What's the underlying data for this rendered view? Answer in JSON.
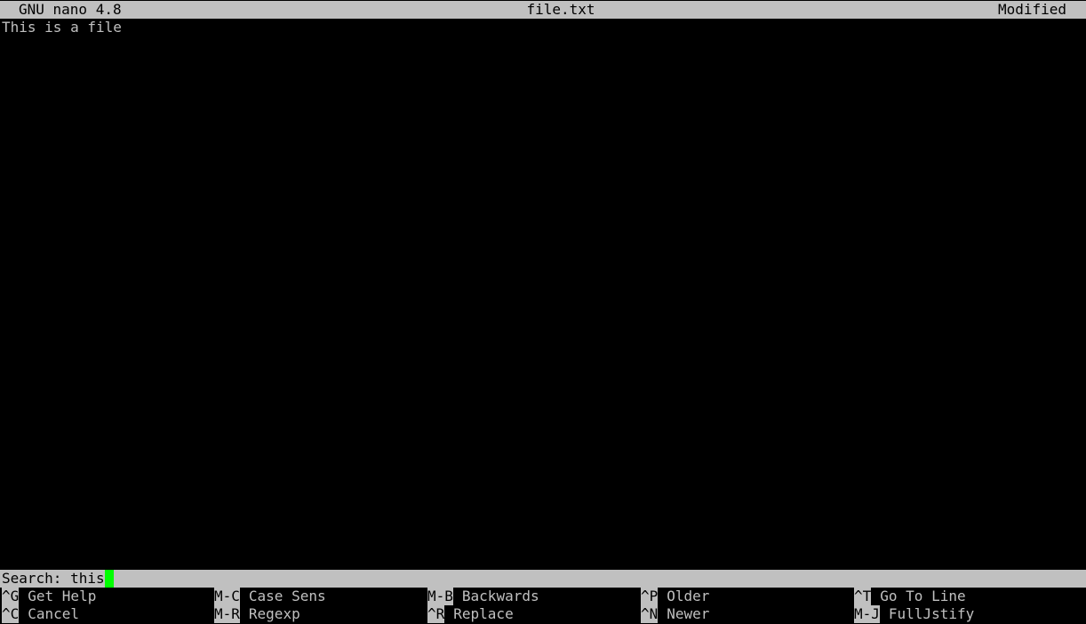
{
  "titlebar": {
    "app": "GNU nano 4.8",
    "filename": "file.txt",
    "status": "Modified"
  },
  "editor": {
    "lines": [
      "This is a file"
    ]
  },
  "prompt": {
    "label": "Search:",
    "value": "this"
  },
  "shortcuts": {
    "row1": [
      {
        "key": "^G",
        "label": "Get Help"
      },
      {
        "key": "M-C",
        "label": "Case Sens"
      },
      {
        "key": "M-B",
        "label": "Backwards"
      },
      {
        "key": "^P",
        "label": "Older"
      },
      {
        "key": "^T",
        "label": "Go To Line"
      }
    ],
    "row2": [
      {
        "key": "^C",
        "label": "Cancel"
      },
      {
        "key": "M-R",
        "label": "Regexp"
      },
      {
        "key": "^R",
        "label": "Replace"
      },
      {
        "key": "^N",
        "label": "Newer"
      },
      {
        "key": "M-J",
        "label": "FullJstify"
      }
    ]
  },
  "colors": {
    "background": "#000000",
    "bar": "#c0c0c0",
    "text": "#c0c0c0",
    "cursor": "#00ff00"
  }
}
